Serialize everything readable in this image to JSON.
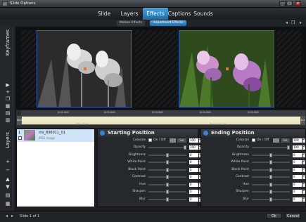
{
  "window": {
    "title": "Slide Options",
    "minimize": "_",
    "maximize": "□",
    "close": "x"
  },
  "tabs": [
    "Slide",
    "Layers",
    "Effects",
    "Captions",
    "Sounds"
  ],
  "subtabs": [
    "Motion Effects",
    "Adjustment Effects"
  ],
  "side_labels": {
    "keyframes": "Keyframes",
    "layers": "Layers"
  },
  "timeline": {
    "ticks": [
      "0:01.000",
      "0:02.000",
      "0:03.000",
      "0:04.000",
      "0:05.000"
    ],
    "slide_time": "Slide Time",
    "transition_out": "Transition Out",
    "start_marker": "Start",
    "end_marker": "End"
  },
  "layer": {
    "number": "1",
    "name": "iris_836011_01",
    "type": "JPEG image"
  },
  "start_panel": {
    "title": "Starting Position"
  },
  "end_panel": {
    "title": "Ending Position"
  },
  "adjustments": {
    "colorize": "Colorize",
    "on_off": "On / Off",
    "set": "Set",
    "labels": [
      "Opacity",
      "Brightness",
      "White Point",
      "Black Point",
      "Contrast",
      "Hue",
      "Sharpen",
      "Blur"
    ],
    "start_values": [
      "100",
      "100",
      "0",
      "0",
      "0",
      "0",
      "0",
      "0",
      "0"
    ],
    "end_values": [
      "100",
      "100",
      "0",
      "0",
      "0",
      "0",
      "0",
      "0",
      "0"
    ]
  },
  "status": {
    "slide_info": "Slide 1 of 1",
    "ok": "Ok",
    "cancel": "Cancel"
  },
  "colors": {
    "accent": "#2f86c9",
    "frame_border": "#3a63b5"
  }
}
